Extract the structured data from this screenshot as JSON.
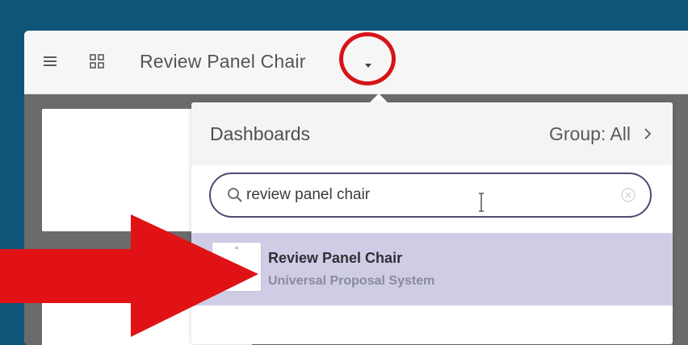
{
  "header": {
    "menu_icon": "hamburger-menu-icon",
    "apps_icon": "grid-apps-icon",
    "title": "Review Panel Chair",
    "caret_icon": "caret-down-icon"
  },
  "dashboard_dropdown": {
    "title": "Dashboards",
    "group_filter_label": "Group: All",
    "group_filter_icon": "chevron-right-icon",
    "search": {
      "value": "review panel chair",
      "icon": "search-icon",
      "clear_icon": "clear-circle-icon"
    },
    "results": [
      {
        "title": "Review Panel Chair",
        "subtitle": "Universal Proposal System",
        "selected": true
      }
    ]
  },
  "annotations": {
    "circle_color": "#d61418",
    "arrow_color": "#e11216"
  },
  "colors": {
    "window_background": "#0e5677",
    "selected_row": "#cfcde6",
    "search_border": "#4c4c72"
  }
}
